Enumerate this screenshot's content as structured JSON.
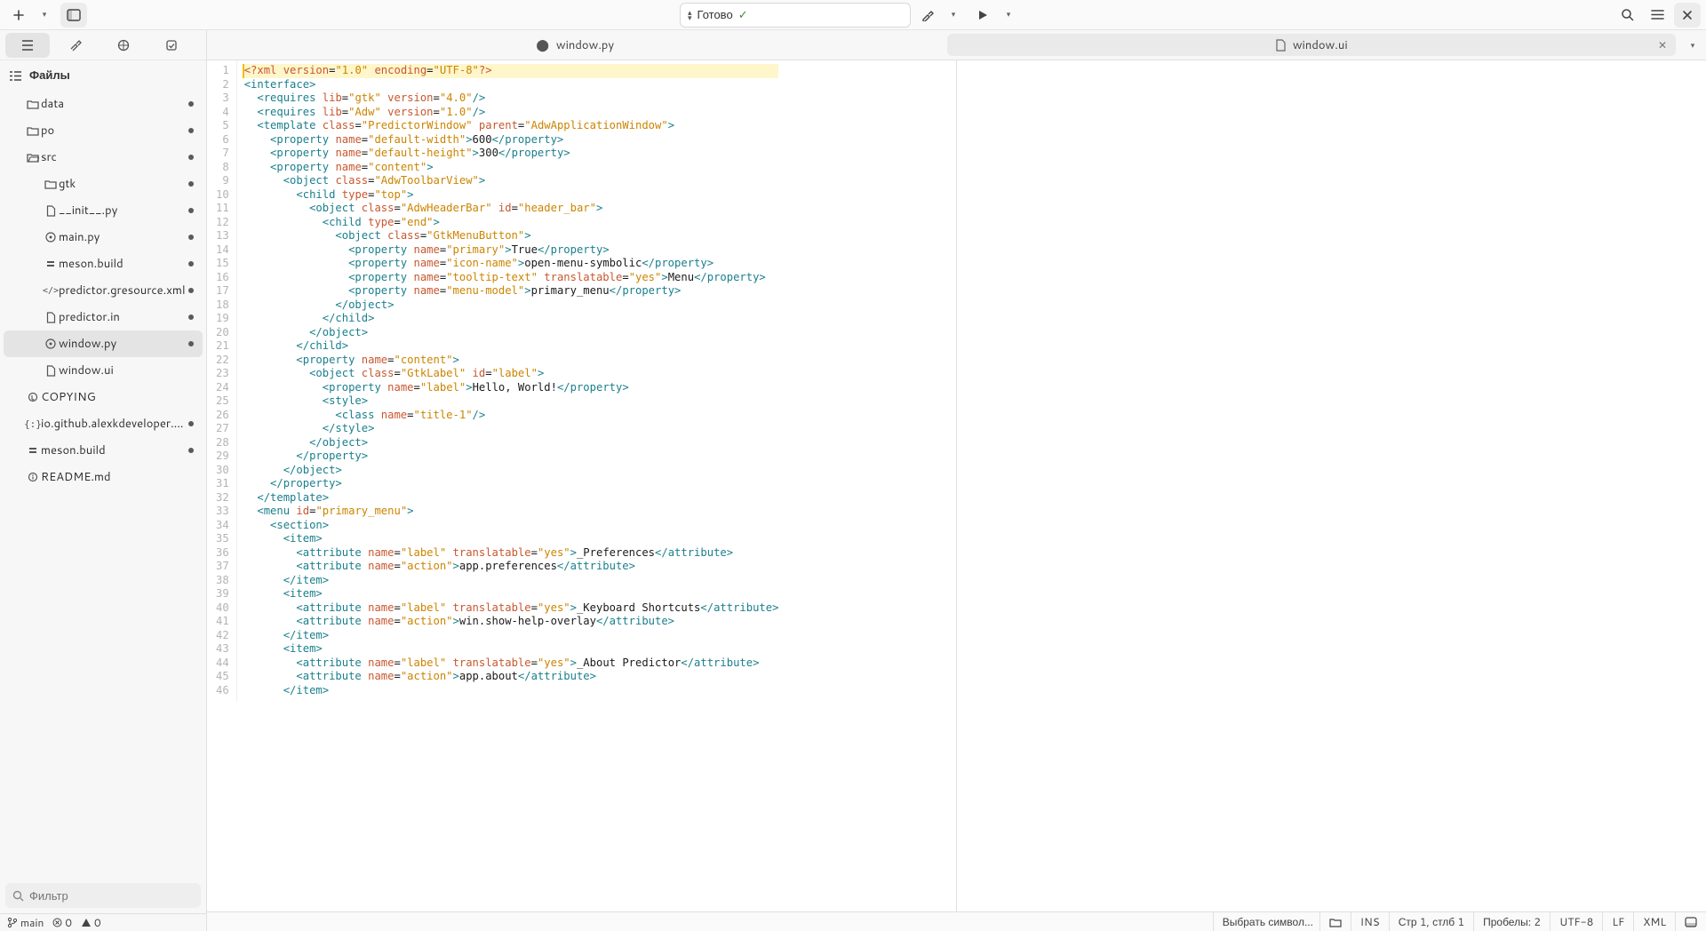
{
  "toolbar": {
    "status_text": "Готово",
    "status_check": "✓"
  },
  "sidebar": {
    "header": "Файлы",
    "filter_placeholder": "Фильтр",
    "items": [
      {
        "icon": "folder",
        "label": "data",
        "indent": 1,
        "dot": true,
        "sel": false
      },
      {
        "icon": "folder",
        "label": "po",
        "indent": 1,
        "dot": true,
        "sel": false
      },
      {
        "icon": "folder-open",
        "label": "src",
        "indent": 1,
        "dot": true,
        "sel": false
      },
      {
        "icon": "folder",
        "label": "gtk",
        "indent": 2,
        "dot": true,
        "sel": false
      },
      {
        "icon": "file",
        "label": "__init__.py",
        "indent": 2,
        "dot": true,
        "sel": false
      },
      {
        "icon": "py",
        "label": "main.py",
        "indent": 2,
        "dot": true,
        "sel": false
      },
      {
        "icon": "meson",
        "label": "meson.build",
        "indent": 2,
        "dot": true,
        "sel": false
      },
      {
        "icon": "xml",
        "label": "predictor.gresource.xml",
        "indent": 2,
        "dot": true,
        "sel": false
      },
      {
        "icon": "file",
        "label": "predictor.in",
        "indent": 2,
        "dot": true,
        "sel": false
      },
      {
        "icon": "py",
        "label": "window.py",
        "indent": 2,
        "dot": true,
        "sel": true
      },
      {
        "icon": "file",
        "label": "window.ui",
        "indent": 2,
        "dot": false,
        "sel": false
      },
      {
        "icon": "copy",
        "label": "COPYING",
        "indent": 1,
        "dot": false,
        "sel": false
      },
      {
        "icon": "json",
        "label": "io.github.alexkdeveloper.pre…",
        "indent": 1,
        "dot": true,
        "sel": false
      },
      {
        "icon": "meson",
        "label": "meson.build",
        "indent": 1,
        "dot": true,
        "sel": false
      },
      {
        "icon": "md",
        "label": "README.md",
        "indent": 1,
        "dot": false,
        "sel": false
      }
    ]
  },
  "vcs": {
    "branch": "main",
    "errors": "0",
    "warnings": "0"
  },
  "tabs": [
    {
      "label": "window.py",
      "icon": "py",
      "active": true,
      "closable": false
    },
    {
      "label": "window.ui",
      "icon": "file",
      "active": false,
      "closable": true
    }
  ],
  "code": {
    "lines": [
      {
        "n": 1,
        "h": "<span class='pi'>&lt;?xml</span> <span class='attr'>version</span>=<span class='str'>\"1.0\"</span> <span class='attr'>encoding</span>=<span class='str'>\"UTF-8\"</span><span class='pi'>?&gt;</span>"
      },
      {
        "n": 2,
        "h": "<span class='tag'>&lt;interface&gt;</span>"
      },
      {
        "n": 3,
        "h": "  <span class='tag'>&lt;requires</span> <span class='attr'>lib</span>=<span class='str'>\"gtk\"</span> <span class='attr'>version</span>=<span class='str'>\"4.0\"</span><span class='tag'>/&gt;</span>"
      },
      {
        "n": 4,
        "h": "  <span class='tag'>&lt;requires</span> <span class='attr'>lib</span>=<span class='str'>\"Adw\"</span> <span class='attr'>version</span>=<span class='str'>\"1.0\"</span><span class='tag'>/&gt;</span>"
      },
      {
        "n": 5,
        "h": "  <span class='tag'>&lt;template</span> <span class='attr'>class</span>=<span class='str'>\"PredictorWindow\"</span> <span class='attr'>parent</span>=<span class='str'>\"AdwApplicationWindow\"</span><span class='tag'>&gt;</span>"
      },
      {
        "n": 6,
        "h": "    <span class='tag'>&lt;property</span> <span class='attr'>name</span>=<span class='str'>\"default-width\"</span><span class='tag'>&gt;</span>600<span class='tag'>&lt;/property&gt;</span>"
      },
      {
        "n": 7,
        "h": "    <span class='tag'>&lt;property</span> <span class='attr'>name</span>=<span class='str'>\"default-height\"</span><span class='tag'>&gt;</span>300<span class='tag'>&lt;/property&gt;</span>"
      },
      {
        "n": 8,
        "h": "    <span class='tag'>&lt;property</span> <span class='attr'>name</span>=<span class='str'>\"content\"</span><span class='tag'>&gt;</span>"
      },
      {
        "n": 9,
        "h": "      <span class='tag'>&lt;object</span> <span class='attr'>class</span>=<span class='str'>\"AdwToolbarView\"</span><span class='tag'>&gt;</span>"
      },
      {
        "n": 10,
        "h": "        <span class='tag'>&lt;child</span> <span class='attr'>type</span>=<span class='str'>\"top\"</span><span class='tag'>&gt;</span>"
      },
      {
        "n": 11,
        "h": "          <span class='tag'>&lt;object</span> <span class='attr'>class</span>=<span class='str'>\"AdwHeaderBar\"</span> <span class='attr'>id</span>=<span class='str'>\"header_bar\"</span><span class='tag'>&gt;</span>"
      },
      {
        "n": 12,
        "h": "            <span class='tag'>&lt;child</span> <span class='attr'>type</span>=<span class='str'>\"end\"</span><span class='tag'>&gt;</span>"
      },
      {
        "n": 13,
        "h": "              <span class='tag'>&lt;object</span> <span class='attr'>class</span>=<span class='str'>\"GtkMenuButton\"</span><span class='tag'>&gt;</span>"
      },
      {
        "n": 14,
        "h": "                <span class='tag'>&lt;property</span> <span class='attr'>name</span>=<span class='str'>\"primary\"</span><span class='tag'>&gt;</span>True<span class='tag'>&lt;/property&gt;</span>"
      },
      {
        "n": 15,
        "h": "                <span class='tag'>&lt;property</span> <span class='attr'>name</span>=<span class='str'>\"icon-name\"</span><span class='tag'>&gt;</span>open-menu-symbolic<span class='tag'>&lt;/property&gt;</span>"
      },
      {
        "n": 16,
        "h": "                <span class='tag'>&lt;property</span> <span class='attr'>name</span>=<span class='str'>\"tooltip-text\"</span> <span class='attr'>translatable</span>=<span class='str'>\"yes\"</span><span class='tag'>&gt;</span>Menu<span class='tag'>&lt;/property&gt;</span>"
      },
      {
        "n": 17,
        "h": "                <span class='tag'>&lt;property</span> <span class='attr'>name</span>=<span class='str'>\"menu-model\"</span><span class='tag'>&gt;</span>primary_menu<span class='tag'>&lt;/property&gt;</span>"
      },
      {
        "n": 18,
        "h": "              <span class='tag'>&lt;/object&gt;</span>"
      },
      {
        "n": 19,
        "h": "            <span class='tag'>&lt;/child&gt;</span>"
      },
      {
        "n": 20,
        "h": "          <span class='tag'>&lt;/object&gt;</span>"
      },
      {
        "n": 21,
        "h": "        <span class='tag'>&lt;/child&gt;</span>"
      },
      {
        "n": 22,
        "h": "        <span class='tag'>&lt;property</span> <span class='attr'>name</span>=<span class='str'>\"content\"</span><span class='tag'>&gt;</span>"
      },
      {
        "n": 23,
        "h": "          <span class='tag'>&lt;object</span> <span class='attr'>class</span>=<span class='str'>\"GtkLabel\"</span> <span class='attr'>id</span>=<span class='str'>\"label\"</span><span class='tag'>&gt;</span>"
      },
      {
        "n": 24,
        "h": "            <span class='tag'>&lt;property</span> <span class='attr'>name</span>=<span class='str'>\"label\"</span><span class='tag'>&gt;</span>Hello, World!<span class='tag'>&lt;/property&gt;</span>"
      },
      {
        "n": 25,
        "h": "            <span class='tag'>&lt;style&gt;</span>"
      },
      {
        "n": 26,
        "h": "              <span class='tag'>&lt;class</span> <span class='attr'>name</span>=<span class='str'>\"title-1\"</span><span class='tag'>/&gt;</span>"
      },
      {
        "n": 27,
        "h": "            <span class='tag'>&lt;/style&gt;</span>"
      },
      {
        "n": 28,
        "h": "          <span class='tag'>&lt;/object&gt;</span>"
      },
      {
        "n": 29,
        "h": "        <span class='tag'>&lt;/property&gt;</span>"
      },
      {
        "n": 30,
        "h": "      <span class='tag'>&lt;/object&gt;</span>"
      },
      {
        "n": 31,
        "h": "    <span class='tag'>&lt;/property&gt;</span>"
      },
      {
        "n": 32,
        "h": "  <span class='tag'>&lt;/template&gt;</span>"
      },
      {
        "n": 33,
        "h": "  <span class='tag'>&lt;menu</span> <span class='attr'>id</span>=<span class='str'>\"primary_menu\"</span><span class='tag'>&gt;</span>"
      },
      {
        "n": 34,
        "h": "    <span class='tag'>&lt;section&gt;</span>"
      },
      {
        "n": 35,
        "h": "      <span class='tag'>&lt;item&gt;</span>"
      },
      {
        "n": 36,
        "h": "        <span class='tag'>&lt;attribute</span> <span class='attr'>name</span>=<span class='str'>\"label\"</span> <span class='attr'>translatable</span>=<span class='str'>\"yes\"</span><span class='tag'>&gt;</span>_Preferences<span class='tag'>&lt;/attribute&gt;</span>"
      },
      {
        "n": 37,
        "h": "        <span class='tag'>&lt;attribute</span> <span class='attr'>name</span>=<span class='str'>\"action\"</span><span class='tag'>&gt;</span>app.preferences<span class='tag'>&lt;/attribute&gt;</span>"
      },
      {
        "n": 38,
        "h": "      <span class='tag'>&lt;/item&gt;</span>"
      },
      {
        "n": 39,
        "h": "      <span class='tag'>&lt;item&gt;</span>"
      },
      {
        "n": 40,
        "h": "        <span class='tag'>&lt;attribute</span> <span class='attr'>name</span>=<span class='str'>\"label\"</span> <span class='attr'>translatable</span>=<span class='str'>\"yes\"</span><span class='tag'>&gt;</span>_Keyboard Shortcuts<span class='tag'>&lt;/attribute&gt;</span>"
      },
      {
        "n": 41,
        "h": "        <span class='tag'>&lt;attribute</span> <span class='attr'>name</span>=<span class='str'>\"action\"</span><span class='tag'>&gt;</span>win.show-help-overlay<span class='tag'>&lt;/attribute&gt;</span>"
      },
      {
        "n": 42,
        "h": "      <span class='tag'>&lt;/item&gt;</span>"
      },
      {
        "n": 43,
        "h": "      <span class='tag'>&lt;item&gt;</span>"
      },
      {
        "n": 44,
        "h": "        <span class='tag'>&lt;attribute</span> <span class='attr'>name</span>=<span class='str'>\"label\"</span> <span class='attr'>translatable</span>=<span class='str'>\"yes\"</span><span class='tag'>&gt;</span>_About Predictor<span class='tag'>&lt;/attribute&gt;</span>"
      },
      {
        "n": 45,
        "h": "        <span class='tag'>&lt;attribute</span> <span class='attr'>name</span>=<span class='str'>\"action\"</span><span class='tag'>&gt;</span>app.about<span class='tag'>&lt;/attribute&gt;</span>"
      },
      {
        "n": 46,
        "h": "      <span class='tag'>&lt;/item&gt;</span>"
      }
    ]
  },
  "status": {
    "symbol": "Выбрать символ…",
    "ins": "INS",
    "position": "Стр 1, стлб 1",
    "spaces": "Пробелы: 2",
    "encoding": "UTF-8",
    "eol": "LF",
    "lang": "XML"
  }
}
